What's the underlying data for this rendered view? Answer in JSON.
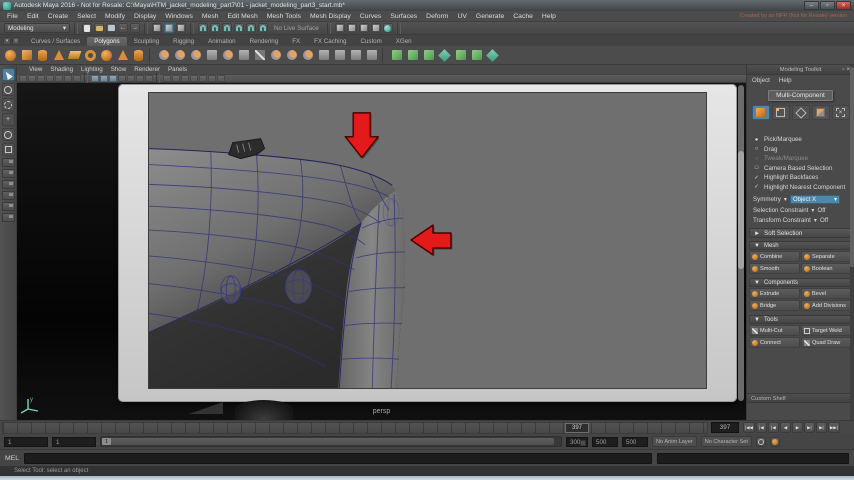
{
  "icons": {
    "caret": "▾",
    "tri_down": "▼",
    "tri_right": "►",
    "close": "×",
    "minimize": "–",
    "maximize": "▫",
    "multi_cross": "×",
    "undo_arrow": "←",
    "redo_arrow": "→",
    "shelf_menu": "▾",
    "shelf_tab": "≡"
  },
  "window": {
    "title": "Autodesk Maya 2016 - Not for Resale: C:\\Maya\\HTM_jacket_modeling_part7\\01 - jacket_modeling_part3_start.mb*"
  },
  "menu_bar": {
    "items": [
      "File",
      "Edit",
      "Create",
      "Select",
      "Modify",
      "Display",
      "Windows",
      "Mesh",
      "Edit Mesh",
      "Mesh Tools",
      "Mesh Display",
      "Curves",
      "Surfaces",
      "Deform",
      "UV",
      "Generate",
      "Cache",
      "Help"
    ],
    "nfr_notice": "Created by an NFR (Not for Resale) version"
  },
  "status_line": {
    "menu_set": "Modeling",
    "no_live_surface": "No Live Surface"
  },
  "shelf": {
    "active_tab": "Polygons",
    "tabs": [
      "Curves / Surfaces",
      "Polygons",
      "Sculpting",
      "Rigging",
      "Animation",
      "Rendering",
      "FX",
      "FX Caching",
      "Custom",
      "XGen"
    ],
    "icons": [
      {
        "n": "poly-sphere",
        "c": "osph"
      },
      {
        "n": "poly-cube",
        "c": "ocube"
      },
      {
        "n": "poly-cylinder",
        "c": "ocyl"
      },
      {
        "n": "poly-cone",
        "c": "ocone"
      },
      {
        "n": "poly-plane",
        "c": "oplane"
      },
      {
        "n": "poly-torus",
        "c": "otorus"
      },
      {
        "n": "poly-disc",
        "c": "osph"
      },
      {
        "n": "platonic-solid",
        "c": "ocone"
      },
      {
        "n": "poly-pipe",
        "c": "ocyl"
      },
      {
        "n": "divider",
        "c": "shdiv"
      },
      {
        "n": "combine",
        "c": "gmix"
      },
      {
        "n": "boolean-union",
        "c": "gmix"
      },
      {
        "n": "boolean-difference",
        "c": "gmix"
      },
      {
        "n": "duplicate",
        "c": "gsq"
      },
      {
        "n": "mirror-geometry",
        "c": "gmix"
      },
      {
        "n": "extrude",
        "c": "gsq"
      },
      {
        "n": "multi-cut",
        "c": "gpen"
      },
      {
        "n": "bevel",
        "c": "gmix"
      },
      {
        "n": "bridge",
        "c": "gmix"
      },
      {
        "n": "smooth",
        "c": "gmix"
      },
      {
        "n": "add-divisions",
        "c": "gsq"
      },
      {
        "n": "sculpt-tool",
        "c": "gsq"
      },
      {
        "n": "lattice",
        "c": "gsq"
      },
      {
        "n": "poly-reduce",
        "c": "gsq"
      },
      {
        "n": "divider",
        "c": "shdiv"
      },
      {
        "n": "quad-draw",
        "c": "grn"
      },
      {
        "n": "make-live",
        "c": "grn"
      },
      {
        "n": "quad-fill",
        "c": "grn"
      },
      {
        "n": "quad-cube",
        "c": "grn2"
      },
      {
        "n": "quad-relax",
        "c": "grn"
      },
      {
        "n": "quad-grid",
        "c": "grn"
      },
      {
        "n": "xgen-tool",
        "c": "grn2"
      }
    ]
  },
  "viewport": {
    "panel_menu": [
      "View",
      "Shading",
      "Lighting",
      "Show",
      "Renderer",
      "Panels"
    ],
    "camera_label": "persp",
    "axis_label": "y",
    "toolbar_icons": [
      "select-camera",
      "lock-camera",
      "camera-attributes",
      "bookmark",
      "image-plane",
      "2d-pan-zoom",
      "grease-pencil",
      "divider",
      "grid",
      "film-gate",
      "resolution-gate",
      "gate-mask",
      "field-chart",
      "safe-action",
      "safe-title",
      "divider",
      "wireframe",
      "shaded",
      "textured",
      "lights",
      "shadows",
      "occlusion",
      "xray"
    ]
  },
  "toolkit": {
    "title": "Modeling Toolkit",
    "menus": [
      "Object",
      "Help"
    ],
    "mode_label": "Multi-Component",
    "options": [
      {
        "glyph": "●",
        "label": "Pick/Marquee"
      },
      {
        "glyph": "○",
        "label": "Drag"
      },
      {
        "glyph": "○",
        "label": "Tweak/Marquee"
      },
      {
        "glyph": "□",
        "label": "Camera Based Selection"
      },
      {
        "glyph": "✓",
        "label": "Highlight Backfaces"
      },
      {
        "glyph": "✓",
        "label": "Highlight Nearest Component"
      }
    ],
    "symmetry_label": "Symmetry",
    "symmetry_value": "Object X",
    "selection_constraint_label": "Selection Constraint",
    "selection_constraint_value": "Off",
    "transform_constraint_label": "Transform Constraint",
    "transform_constraint_value": "Off",
    "soft_selection_label": "Soft Selection",
    "sections": [
      {
        "title": "Mesh",
        "buttons": [
          "Combine",
          "Separate",
          "Smooth",
          "Boolean"
        ]
      },
      {
        "title": "Components",
        "buttons": [
          "Extrude",
          "Bevel",
          "Bridge",
          "Add Divisions"
        ]
      },
      {
        "title": "Tools",
        "buttons": [
          "Multi-Cut",
          "Target Weld",
          "Connect",
          "Quad Draw"
        ]
      }
    ],
    "custom_shelf_label": "Custom Shelf"
  },
  "timeline": {
    "cursor_frame": "397",
    "current_time": "397",
    "playback": [
      "|◀◀",
      "|◀",
      "|◀",
      "◀",
      "▶",
      "▶|",
      "▶|",
      "▶▶|"
    ]
  },
  "range": {
    "anim_start": "1",
    "playback_start": "1",
    "bar_handle": "1",
    "playback_end": "300",
    "anim_end_a": "500",
    "anim_end_b": "500",
    "anim_layer": "No Anim Layer",
    "character_set": "No Character Set"
  },
  "command_line": {
    "label": "MEL"
  },
  "help_line": {
    "text": "Select Tool: select an object"
  }
}
